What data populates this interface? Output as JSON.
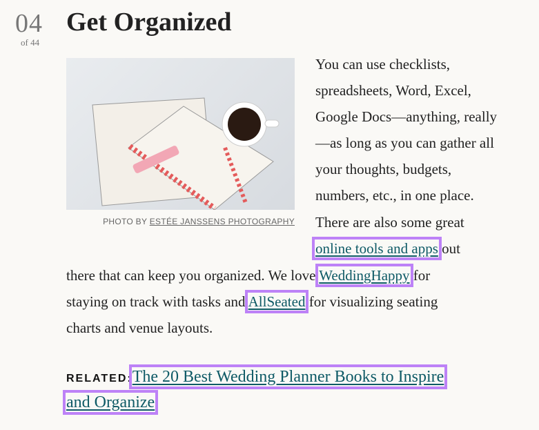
{
  "item": {
    "number": "04",
    "of": "of 44",
    "title": "Get Organized"
  },
  "photo": {
    "credit_prefix": "PHOTO BY",
    "credit_link": "ESTÉE JANSSENS PHOTOGRAPHY"
  },
  "body": {
    "l1": "You can use checklists,",
    "l2": "spreadsheets, Word, Excel,",
    "l3": "Google Docs—anything, really",
    "l4": "—as long as you can gather all",
    "l5": "your thoughts, budgets,",
    "l6": "numbers, etc., in one place.",
    "l7": "There are also some great",
    "link1": "online tools and apps",
    "l8b": "out",
    "l9a": "there that can keep you organized. We love",
    "link2": "WeddingHappy",
    "l9b": "for",
    "l10a": "staying on track with tasks and",
    "link3": "AllSeated",
    "l10b": "for visualizing seating",
    "l11": "charts and venue layouts."
  },
  "related": {
    "label": "RELATED:",
    "link_line1": "The 20 Best Wedding Planner Books to Inspire",
    "link_line2": "and Organize"
  },
  "colors": {
    "link": "#0e5a66",
    "highlight": "#bd82f7",
    "background": "#faf9f6"
  }
}
